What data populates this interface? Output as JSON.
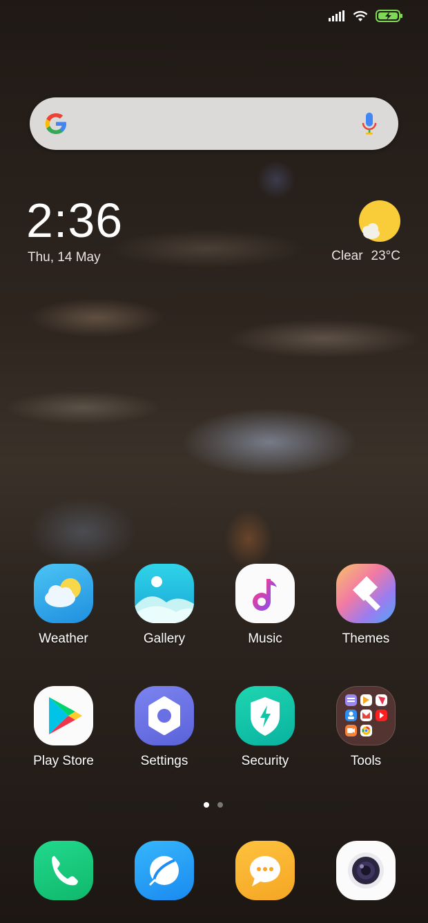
{
  "status": {
    "signal": "signal-icon",
    "wifi": "wifi-icon",
    "battery": "battery-charging-icon"
  },
  "search": {
    "left_icon": "google-icon",
    "right_icon": "mic-icon"
  },
  "clock": {
    "time": "2:36",
    "date": "Thu, 14 May"
  },
  "weather": {
    "condition": "Clear",
    "temperature": "23°C",
    "icon": "sun-cloud-icon"
  },
  "apps": [
    {
      "label": "Weather"
    },
    {
      "label": "Gallery"
    },
    {
      "label": "Music"
    },
    {
      "label": "Themes"
    },
    {
      "label": "Play Store"
    },
    {
      "label": "Settings"
    },
    {
      "label": "Security"
    },
    {
      "label": "Tools"
    }
  ],
  "pager": {
    "current_page": 1,
    "total_pages": 2
  },
  "dock": [
    {
      "icon": "phone-icon"
    },
    {
      "icon": "browser-icon"
    },
    {
      "icon": "messaging-icon"
    },
    {
      "icon": "camera-icon"
    }
  ],
  "colors": {
    "battery": "#7ed957",
    "google_blue": "#4285f4",
    "google_red": "#ea4335",
    "google_yellow": "#fbbc05",
    "google_green": "#34a853"
  }
}
